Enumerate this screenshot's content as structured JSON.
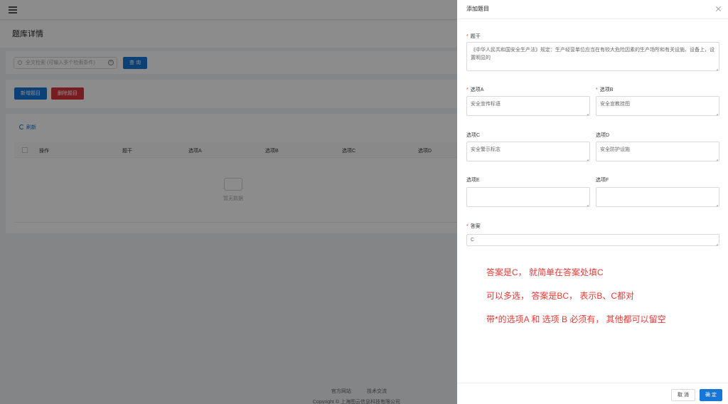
{
  "background": {
    "page_title": "题库详情",
    "search_placeholder": "全文检索 (可输入多个检索条件)",
    "search_button": "查 询",
    "add_button": "新增题目",
    "delete_button": "删除题目",
    "refresh_label": "刷新",
    "columns": [
      "操作",
      "题干",
      "选项A",
      "选项B",
      "选项C",
      "选项D"
    ],
    "empty_text": "暂无数据",
    "footer_links": [
      "官方网站",
      "技术交流"
    ],
    "copyright": "Copyright © 上海图云信息科技有限公司"
  },
  "drawer": {
    "title": "添加题目",
    "stem_label": "题干",
    "stem_value": "《中华人民共和国安全生产法》规定：生产经营单位应当在有较大危险因素的生产场所和有关设施、设备上，设置明显的",
    "option_a_label": "选项A",
    "option_a_value": "安全宣传标语",
    "option_b_label": "选项B",
    "option_b_value": "安全宣教挂图",
    "option_c_label": "选项C",
    "option_c_value": "安全警示标志",
    "option_d_label": "选项D",
    "option_d_value": "安全防护设施",
    "option_e_label": "选项E",
    "option_e_value": "",
    "option_f_label": "选项F",
    "option_f_value": "",
    "answer_label": "答案",
    "answer_value": "C",
    "notes": [
      "答案是C， 就简单在答案处填C",
      "可以多选， 答案是BC， 表示B、C都对",
      "带*的选项A 和 选项 B  必须有， 其他都可以留空"
    ],
    "cancel_button": "取 消",
    "ok_button": "确 定"
  },
  "colors": {
    "primary": "#1677d9",
    "danger": "#d9363e",
    "required": "#e53935"
  }
}
